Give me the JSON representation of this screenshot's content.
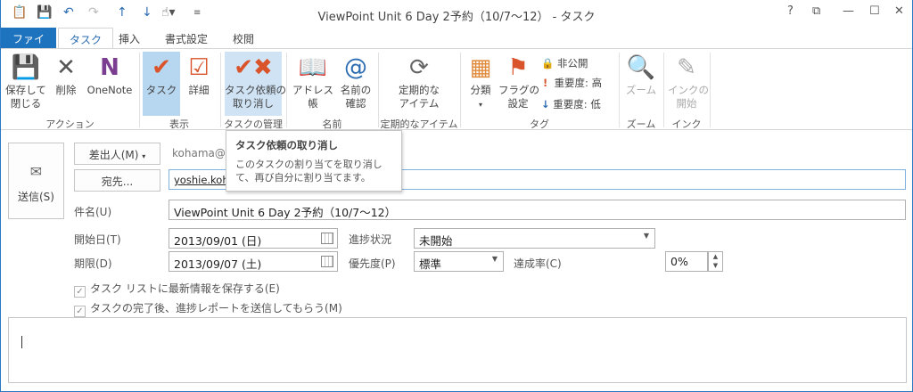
{
  "window": {
    "title": "ViewPoint Unit 6 Day 2予約（10/7～12） - タスク",
    "controls": [
      "?",
      "⧉",
      "—",
      "☐",
      "✕"
    ]
  },
  "qat": {
    "icons": [
      "task-icon",
      "save-icon",
      "undo-icon",
      "redo-icon",
      "up-icon",
      "down-icon",
      "touch-mode-icon",
      "customize-icon"
    ]
  },
  "tabs": [
    "ファイル",
    "タスク",
    "挿入",
    "書式設定",
    "校閲"
  ],
  "ribbon": {
    "groups": [
      "アクション",
      "表示",
      "タスクの管理",
      "名前",
      "定期的なアイテム",
      "タグ",
      "ズーム",
      "インク"
    ],
    "save_close": "保存して\n閉じる",
    "delete": "削除",
    "onenote": "OneNote",
    "task": "タスク",
    "details": "詳細",
    "cancel_assign": "タスク依頼の\n取り消し",
    "address_book": "アドレス帳",
    "check_names": "名前の\n確認",
    "recurrence": "定期的な\nアイテム",
    "categorize": "分類",
    "follow_up": "フラグの\n設定",
    "private": "非公開",
    "high": "重要度: 高",
    "low": "重要度: 低",
    "zoom": "ズーム",
    "ink": "インクの\n開始"
  },
  "tooltip": {
    "title": "タスク依頼の取り消し",
    "desc": "このタスクの割り当てを取り消して、再び自分に割り当てます。"
  },
  "form": {
    "send": "送信(S)",
    "from_btn": "差出人(M)",
    "from_value": "kohama@v",
    "to_btn": "宛先...",
    "to_value": "yoshie.koha",
    "subject_label": "件名(U)",
    "subject": "ViewPoint Unit 6 Day 2予約（10/7～12）",
    "start_label": "開始日(T)",
    "start": "2013/09/01 (日)",
    "due_label": "期限(D)",
    "due": "2013/09/07 (土)",
    "status_label": "進捗状況",
    "status": "未開始",
    "priority_label": "優先度(P)",
    "priority": "標準",
    "complete_label": "達成率(C)",
    "complete": "0%",
    "check1": "タスク リストに最新情報を保存する(E)",
    "check2": "タスクの完了後、進捗レポートを送信してもらう(M)"
  }
}
